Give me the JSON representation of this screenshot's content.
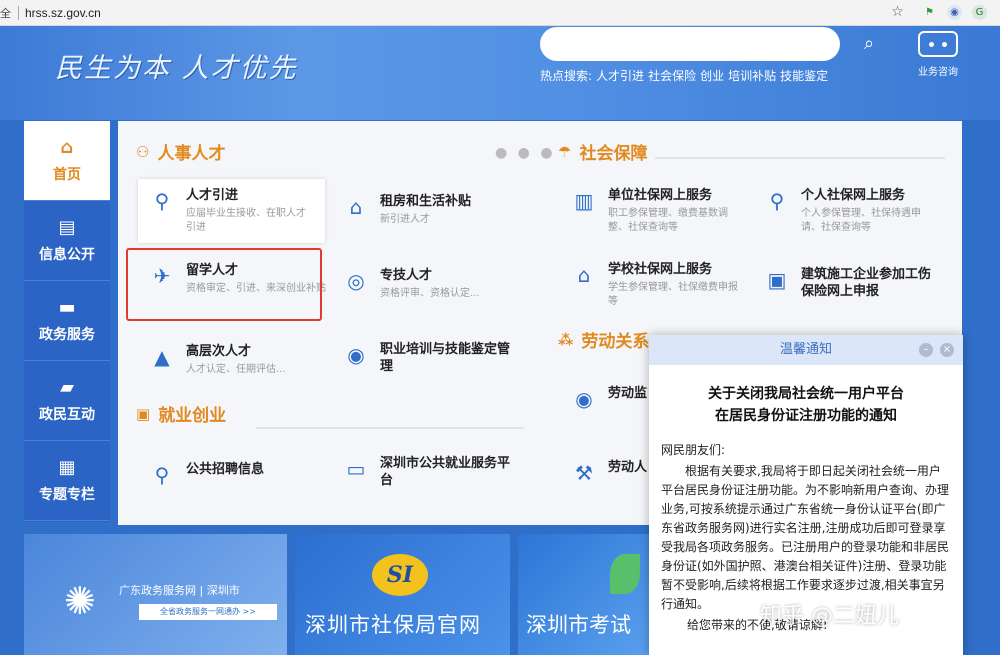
{
  "browser": {
    "security_label": "全",
    "url": "hrss.sz.gov.cn"
  },
  "header": {
    "slogan": "民生为本 人才优先",
    "search_placeholder": "",
    "hot_label": "热点搜索:",
    "hot_links": [
      "人才引进",
      "社会保险",
      "创业",
      "培训补贴",
      "技能鉴定"
    ],
    "robot_label": "业务咨询"
  },
  "sidebar": {
    "items": [
      {
        "label": "首页",
        "icon": "home-icon"
      },
      {
        "label": "信息公开",
        "icon": "clipboard-icon"
      },
      {
        "label": "政务服务",
        "icon": "folder-icon"
      },
      {
        "label": "政民互动",
        "icon": "chat-icon"
      },
      {
        "label": "专题专栏",
        "icon": "grid-icon"
      }
    ]
  },
  "sections": {
    "talent": {
      "title": "人事人才",
      "more": "● ● ●",
      "cards": [
        {
          "title": "人才引进",
          "sub": "应届毕业生接收、在职人才引进"
        },
        {
          "title": "租房和生活补贴",
          "sub": "新引进人才"
        },
        {
          "title": "留学人才",
          "sub": "资格审定、引进、来深创业补贴"
        },
        {
          "title": "专技人才",
          "sub": "资格评审、资格认定..."
        },
        {
          "title": "高层次人才",
          "sub": "人才认定、任期评估..."
        },
        {
          "title": "职业培训与技能鉴定管理",
          "sub": ""
        }
      ]
    },
    "employment": {
      "title": "就业创业",
      "cards": [
        {
          "title": "公共招聘信息",
          "sub": ""
        },
        {
          "title": "深圳市公共就业服务平台",
          "sub": ""
        }
      ]
    },
    "social": {
      "title": "社会保障",
      "cards": [
        {
          "title": "单位社保网上服务",
          "sub": "职工参保管理、缴费基数调整、社保查询等"
        },
        {
          "title": "个人社保网上服务",
          "sub": "个人参保管理、社保待遇申请、社保查询等"
        },
        {
          "title": "学校社保网上服务",
          "sub": "学生参保管理、社保缴费申报等"
        },
        {
          "title": "建筑施工企业参加工伤保险网上申报",
          "sub": ""
        }
      ]
    },
    "labor": {
      "title": "劳动关系",
      "cards": [
        {
          "title": "劳动监",
          "sub": ""
        },
        {
          "title": "劳动人",
          "sub": ""
        }
      ]
    }
  },
  "tiles": {
    "gov": {
      "label": "广东政务服务网 | 深圳市",
      "btn": "全省政务服务一网通办 >>"
    },
    "si": {
      "logo": "SI",
      "label": "深圳市社保局官网"
    },
    "exam": {
      "label": "深圳市考试"
    }
  },
  "popup": {
    "header": "温馨通知",
    "title_line1": "关于关闭我局社会统一用户平台",
    "title_line2": "在居民身份证注册功能的通知",
    "greeting": "网民朋友们:",
    "body": "根据有关要求,我局将于即日起关闭社会统一用户平台居民身份证注册功能。为不影响新用户查询、办理业务,可按系统提示通过广东省统一身份认证平台(即广东省政务服务网)进行实名注册,注册成功后即可登录享受我局各项政务服务。已注册用户的登录功能和非居民身份证(如外国护照、港澳台相关证件)注册、登录功能暂不受影响,后续将根据工作要求逐步过渡,相关事宜另行通知。",
    "closing": "给您带来的不便,敬请谅解!"
  },
  "watermark": "知乎 @二妞儿",
  "colors": {
    "brand": "#2f6fc9",
    "accent": "#e28a1f",
    "highlight": "#e03b2e"
  }
}
